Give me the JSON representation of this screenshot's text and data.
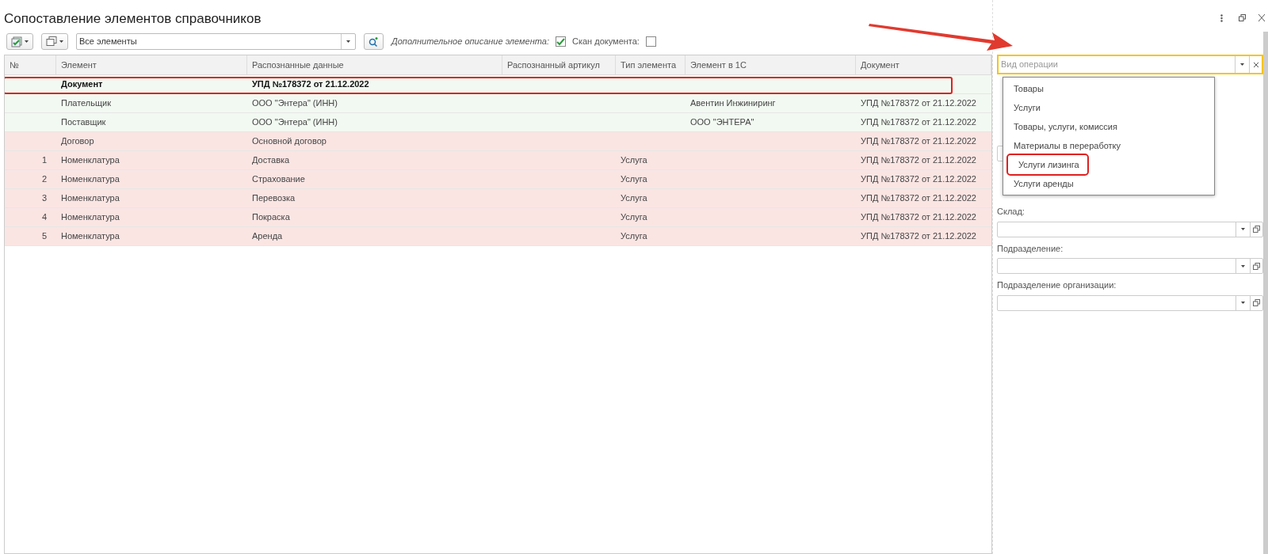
{
  "window": {
    "title": "Сопоставление элементов справочников"
  },
  "toolbar": {
    "filter": {
      "value": "Все элементы"
    },
    "options": [
      {
        "label": "Дополнительное описание элемента:",
        "checked": true
      },
      {
        "label": "Скан документа:",
        "checked": false
      }
    ]
  },
  "table": {
    "columns": [
      "№",
      "Элемент",
      "Распознанные данные",
      "Распознанный артикул",
      "Тип элемента",
      "Элемент в 1С",
      "Документ"
    ],
    "rows": [
      {
        "kind": "header",
        "color": "#f2f9f2",
        "highlighted": true,
        "cells": [
          "",
          "Документ",
          "УПД №178372 от 21.12.2022",
          "",
          "",
          "",
          ""
        ]
      },
      {
        "kind": "item",
        "color": "#f2f9f2",
        "highlighted": false,
        "cells": [
          "",
          "Плательщик",
          "ООО \"Энтера\" (ИНН)",
          "",
          "",
          "Авентин Инжиниринг",
          "УПД №178372 от 21.12.2022"
        ]
      },
      {
        "kind": "item",
        "color": "#f2f9f2",
        "highlighted": false,
        "cells": [
          "",
          "Поставщик",
          "ООО \"Энтера\" (ИНН)",
          "",
          "",
          "ООО \"ЭНТЕРА\"",
          "УПД №178372 от 21.12.2022"
        ]
      },
      {
        "kind": "item",
        "color": "#fae5e3",
        "highlighted": false,
        "cells": [
          "",
          "Договор",
          "Основной договор",
          "",
          "",
          "",
          "УПД №178372 от 21.12.2022"
        ]
      },
      {
        "kind": "item",
        "color": "#fae5e3",
        "highlighted": false,
        "cells": [
          "1",
          "Номенклатура",
          "Доставка",
          "",
          "Услуга",
          "",
          "УПД №178372 от 21.12.2022"
        ]
      },
      {
        "kind": "item",
        "color": "#fae5e3",
        "highlighted": false,
        "cells": [
          "2",
          "Номенклатура",
          "Страхование",
          "",
          "Услуга",
          "",
          "УПД №178372 от 21.12.2022"
        ]
      },
      {
        "kind": "item",
        "color": "#fae5e3",
        "highlighted": false,
        "cells": [
          "3",
          "Номенклатура",
          "Перевозка",
          "",
          "Услуга",
          "",
          "УПД №178372 от 21.12.2022"
        ]
      },
      {
        "kind": "item",
        "color": "#fae5e3",
        "highlighted": false,
        "cells": [
          "4",
          "Номенклатура",
          "Покраска",
          "",
          "Услуга",
          "",
          "УПД №178372 от 21.12.2022"
        ]
      },
      {
        "kind": "item",
        "color": "#fae5e3",
        "highlighted": false,
        "cells": [
          "5",
          "Номенклатура",
          "Аренда",
          "",
          "Услуга",
          "",
          "УПД №178372 от 21.12.2022"
        ]
      }
    ]
  },
  "operation_field": {
    "placeholder": "Вид операции",
    "options": [
      {
        "label": "Товары",
        "highlighted": false
      },
      {
        "label": "Услуги",
        "highlighted": false
      },
      {
        "label": "Товары, услуги, комиссия",
        "highlighted": false
      },
      {
        "label": "Материалы в переработку",
        "highlighted": false
      },
      {
        "label": "Услуги лизинга",
        "highlighted": true
      },
      {
        "label": "Услуги аренды",
        "highlighted": false
      }
    ]
  },
  "fields": [
    {
      "label": "Склад:"
    },
    {
      "label": "Подразделение:"
    },
    {
      "label": "Подразделение организации:"
    }
  ]
}
